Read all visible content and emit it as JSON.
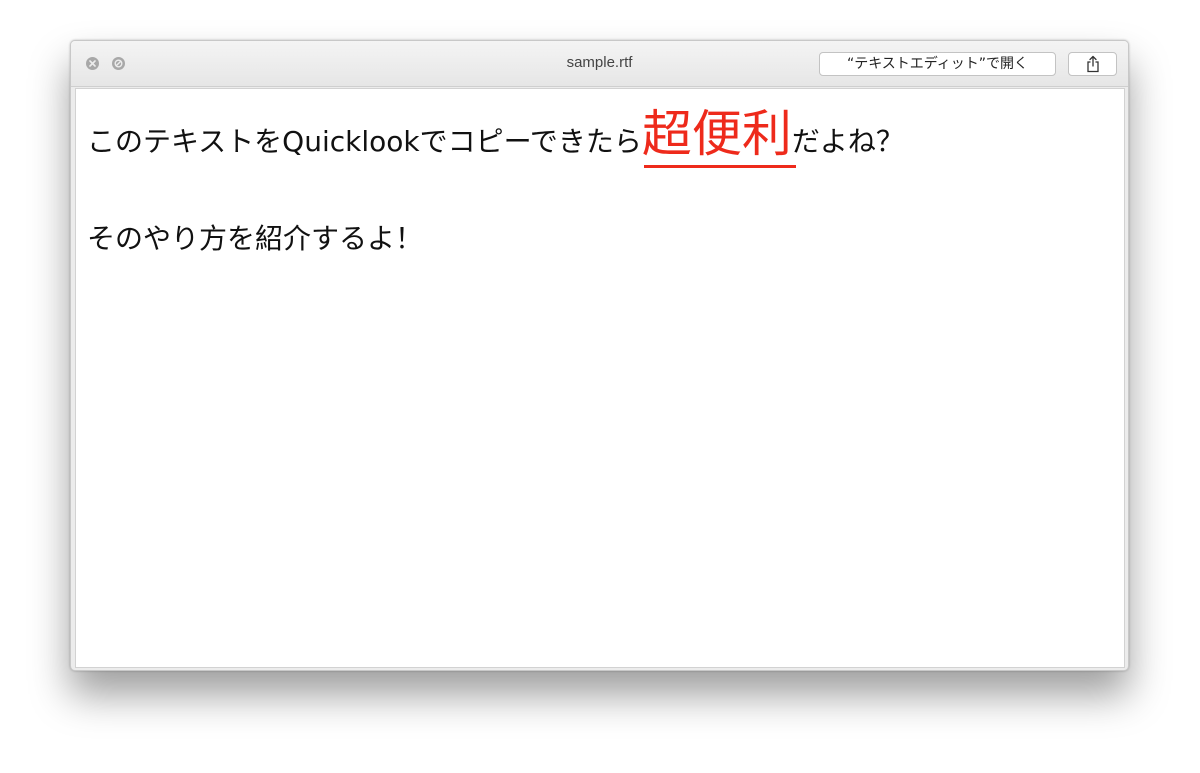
{
  "window": {
    "title": "sample.rtf",
    "open_with_label": "“テキストエディット”で開く",
    "close_icon": "close-icon",
    "fullscreen_icon": "fullscreen-icon",
    "share_icon": "share-icon"
  },
  "document": {
    "line1_before": "このテキストをQuicklookでコピーできたら",
    "line1_emphasis": "超便利",
    "line1_after": "だよね？",
    "line2": "そのやり方を紹介するよ！"
  },
  "colors": {
    "emphasis": "#ee2a1b",
    "text": "#111111"
  }
}
